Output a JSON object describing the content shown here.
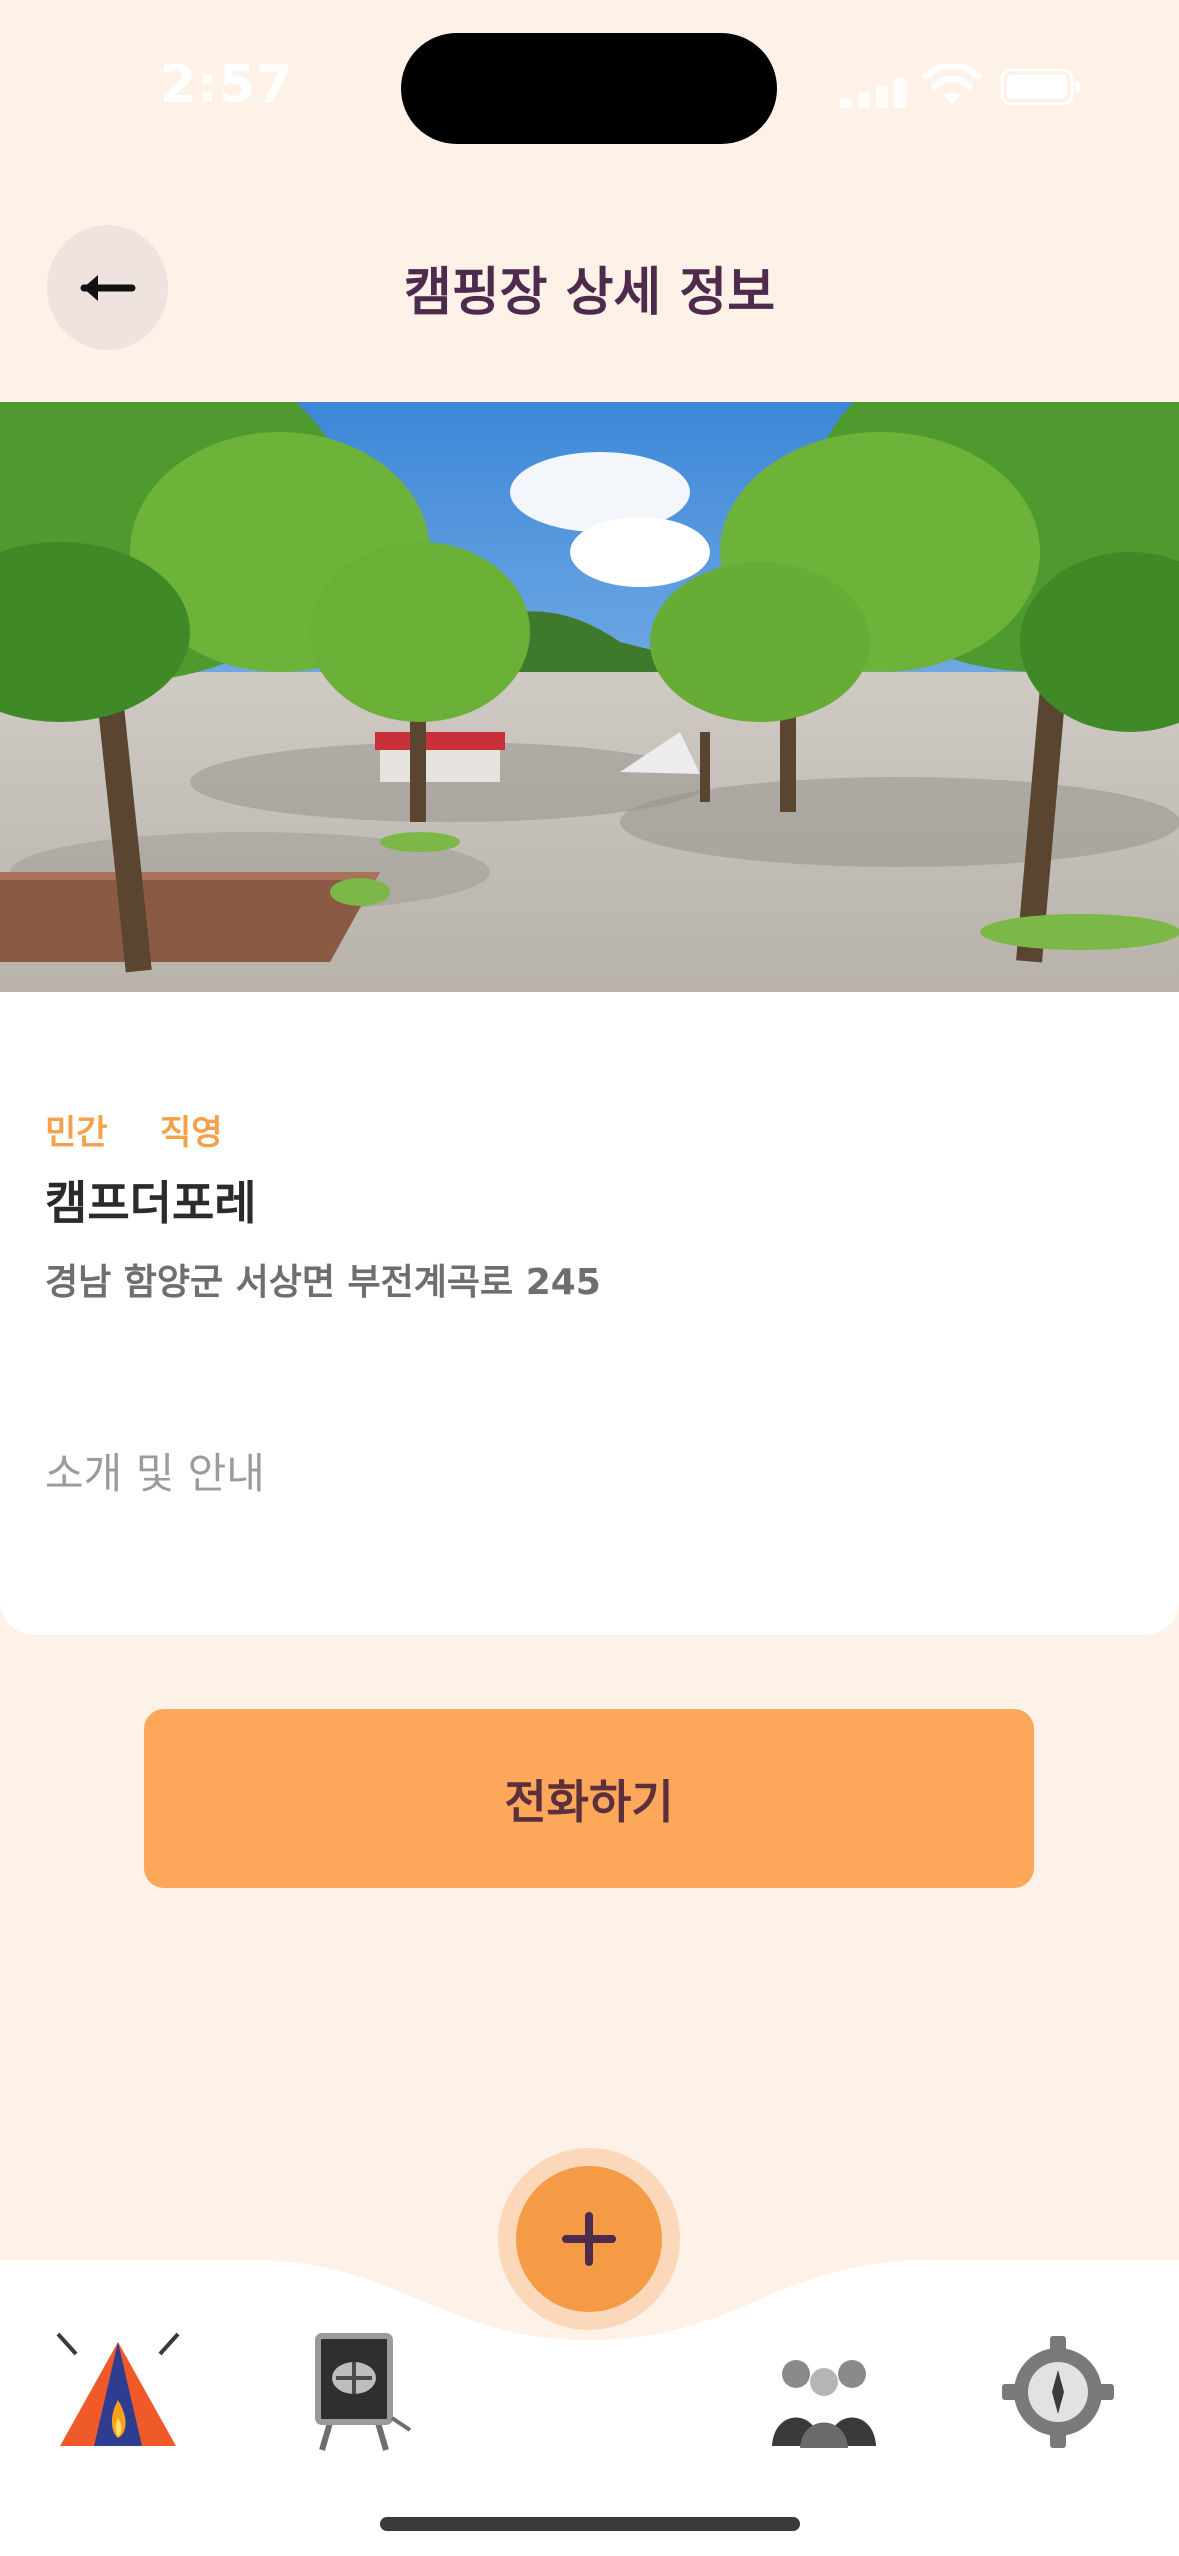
{
  "status_bar": {
    "time": "2:57"
  },
  "header": {
    "title": "캠핑장 상세 정보"
  },
  "camp": {
    "tags": [
      "민간",
      "직영"
    ],
    "name": "캠프더포레",
    "address": "경남 함양군 서상면 부전계곡로 245",
    "intro_label": "소개 및 안내"
  },
  "actions": {
    "call_label": "전화하기"
  },
  "bottom_nav": {
    "items": [
      "campsite-tent-icon",
      "easel-board-icon",
      "people-group-icon",
      "gear-compass-icon"
    ]
  },
  "colors": {
    "background": "#FEF1E8",
    "accent": "#FDA75A",
    "title": "#4E2A4C",
    "tag": "#F5A04B"
  }
}
